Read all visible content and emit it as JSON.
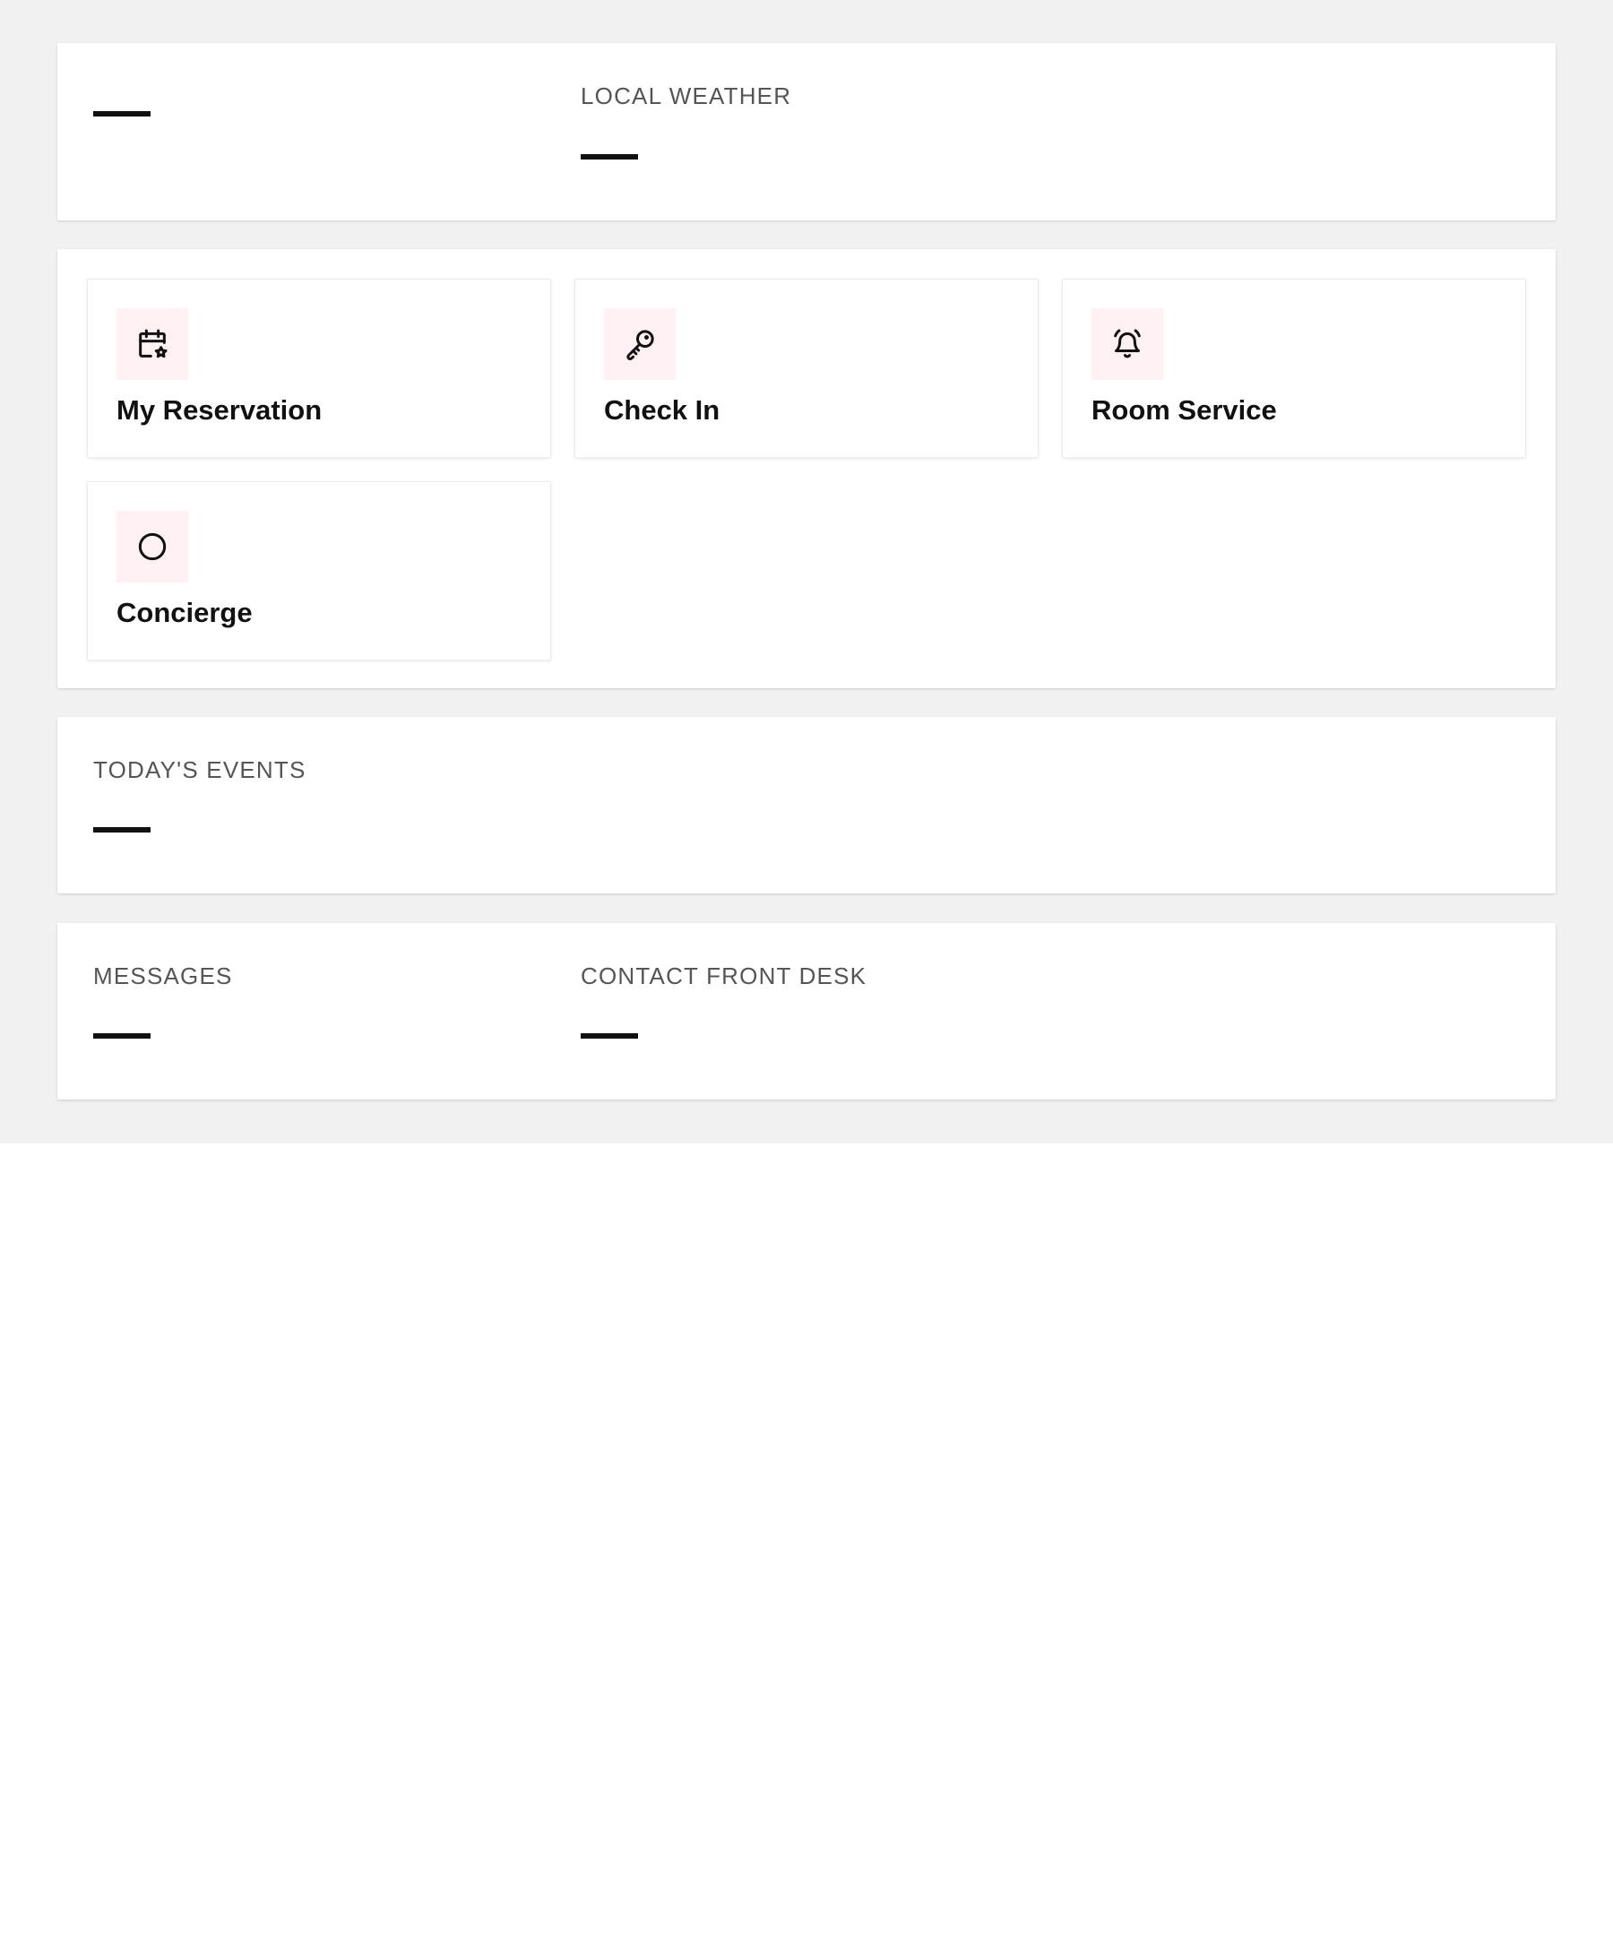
{
  "header": {
    "primary_value": "—",
    "weather": {
      "label": "LOCAL WEATHER",
      "value": "—"
    }
  },
  "actions": [
    {
      "label": "My Reservation",
      "icon": "calendar-star-icon"
    },
    {
      "label": "Check In",
      "icon": "key-icon"
    },
    {
      "label": "Room Service",
      "icon": "bell-ringing-icon"
    },
    {
      "label": "Concierge",
      "icon": "circle-icon"
    }
  ],
  "events": {
    "label": "TODAY'S EVENTS",
    "value": "—"
  },
  "messages": {
    "label": "MESSAGES",
    "value": "—"
  },
  "front_desk": {
    "label": "CONTACT FRONT DESK",
    "value": "—"
  },
  "colors": {
    "icon_tile_bg": "#fff0f3",
    "page_bg": "#f1f1f1",
    "text": "#111111",
    "muted_label": "#555555"
  }
}
